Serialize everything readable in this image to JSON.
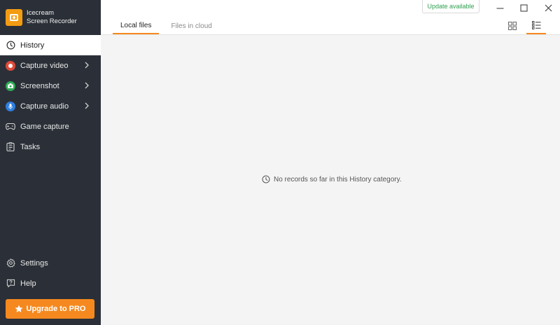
{
  "app": {
    "brand_line1": "Icecream",
    "brand_line2": "Screen Recorder",
    "accent_color": "#f5891f"
  },
  "sidebar": {
    "items": [
      {
        "label": "History",
        "icon": "clock-icon",
        "active": true
      },
      {
        "label": "Capture video",
        "icon": "record-icon",
        "has_submenu": true
      },
      {
        "label": "Screenshot",
        "icon": "camera-icon",
        "has_submenu": true
      },
      {
        "label": "Capture audio",
        "icon": "microphone-icon",
        "has_submenu": true
      },
      {
        "label": "Game capture",
        "icon": "gamepad-icon"
      },
      {
        "label": "Tasks",
        "icon": "tasks-icon"
      }
    ],
    "bottom_items": [
      {
        "label": "Settings",
        "icon": "gear-icon"
      },
      {
        "label": "Help",
        "icon": "help-icon"
      }
    ],
    "upgrade_label": "Upgrade to PRO"
  },
  "topbar": {
    "update_label": "Update available",
    "tabs": [
      {
        "label": "Local files",
        "active": true
      },
      {
        "label": "Files in cloud",
        "active": false
      }
    ]
  },
  "main": {
    "empty_message": "No records so far in this History category."
  }
}
